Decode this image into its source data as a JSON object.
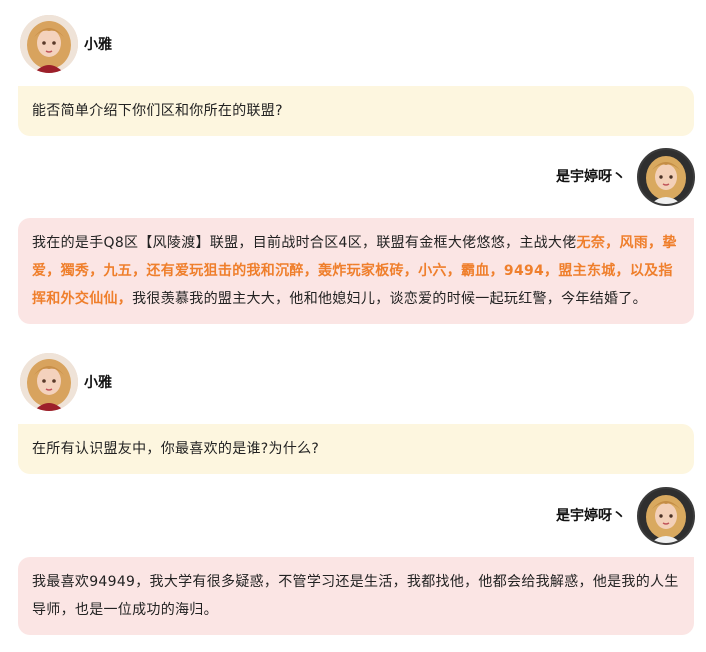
{
  "conversation": {
    "host_name": "小雅",
    "guest_name": "是宇婷呀丶",
    "q1": "能否简单介绍下你们区和你所在的联盟?",
    "a1": {
      "part1": "我在的是手Q8区【风陵渡】联盟，目前战时合区4区，联盟有金框大佬悠悠，主战大佬",
      "highlight": "无奈，风雨，挚爱，獨秀，九五，还有爱玩狙击的我和沉醉，轰炸玩家板砖，小六，霸血，9494，盟主东城，以及指挥和外交仙仙，",
      "part2": "我很羡慕我的盟主大大，他和他媳妇儿，谈恋爱的时候一起玩红警，今年结婚了。"
    },
    "q2": "在所有认识盟友中，你最喜欢的是谁?为什么?",
    "a2": "我最喜欢94949，我大学有很多疑惑，不管学习还是生活，我都找他，他都会给我解惑，他是我的人生导师，也是一位成功的海归。"
  },
  "colors": {
    "question_bubble": "#fdf6df",
    "answer_bubble": "#fbe5e4",
    "highlight": "#ef7f2c"
  },
  "icons": {
    "host_avatar": "blonde-girl-avatar",
    "guest_avatar": "blonde-girl-dark-background-avatar"
  }
}
